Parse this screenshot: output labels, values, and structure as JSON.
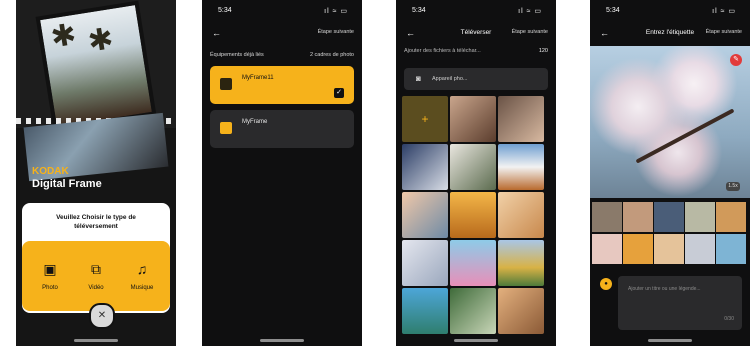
{
  "colors": {
    "accent": "#f6b21b",
    "background": "#0f0f10",
    "card": "#2a2a2c"
  },
  "screen1": {
    "brand": "KODAK",
    "product": "Digital Frame",
    "sheet_title": "Veuillez Choisir le type de téléversement",
    "options": [
      {
        "label": "Photo",
        "icon": "image-icon"
      },
      {
        "label": "Vidéo",
        "icon": "video-icon"
      },
      {
        "label": "Musique",
        "icon": "music-icon"
      }
    ]
  },
  "screen2": {
    "time": "5:34",
    "next": "Étape suivante",
    "header_left": "Équipements déjà liés",
    "header_right": "2 cadres de photo",
    "frames": [
      {
        "name": "MyFrame11",
        "selected": true
      },
      {
        "name": "MyFrame",
        "selected": false
      }
    ]
  },
  "screen3": {
    "time": "5:34",
    "title": "Téléverser",
    "next": "Étape suivante",
    "add_files": "Ajouter des fichiers à téléchar...",
    "count": "120",
    "camera": "Appareil pho..."
  },
  "screen4": {
    "time": "5:34",
    "title": "Entrez l'étiquette",
    "next": "Étape suivante",
    "zoom": "1.5x",
    "caption_placeholder": "Ajouter un titre ou une légende...",
    "caption_count": "0/30"
  }
}
